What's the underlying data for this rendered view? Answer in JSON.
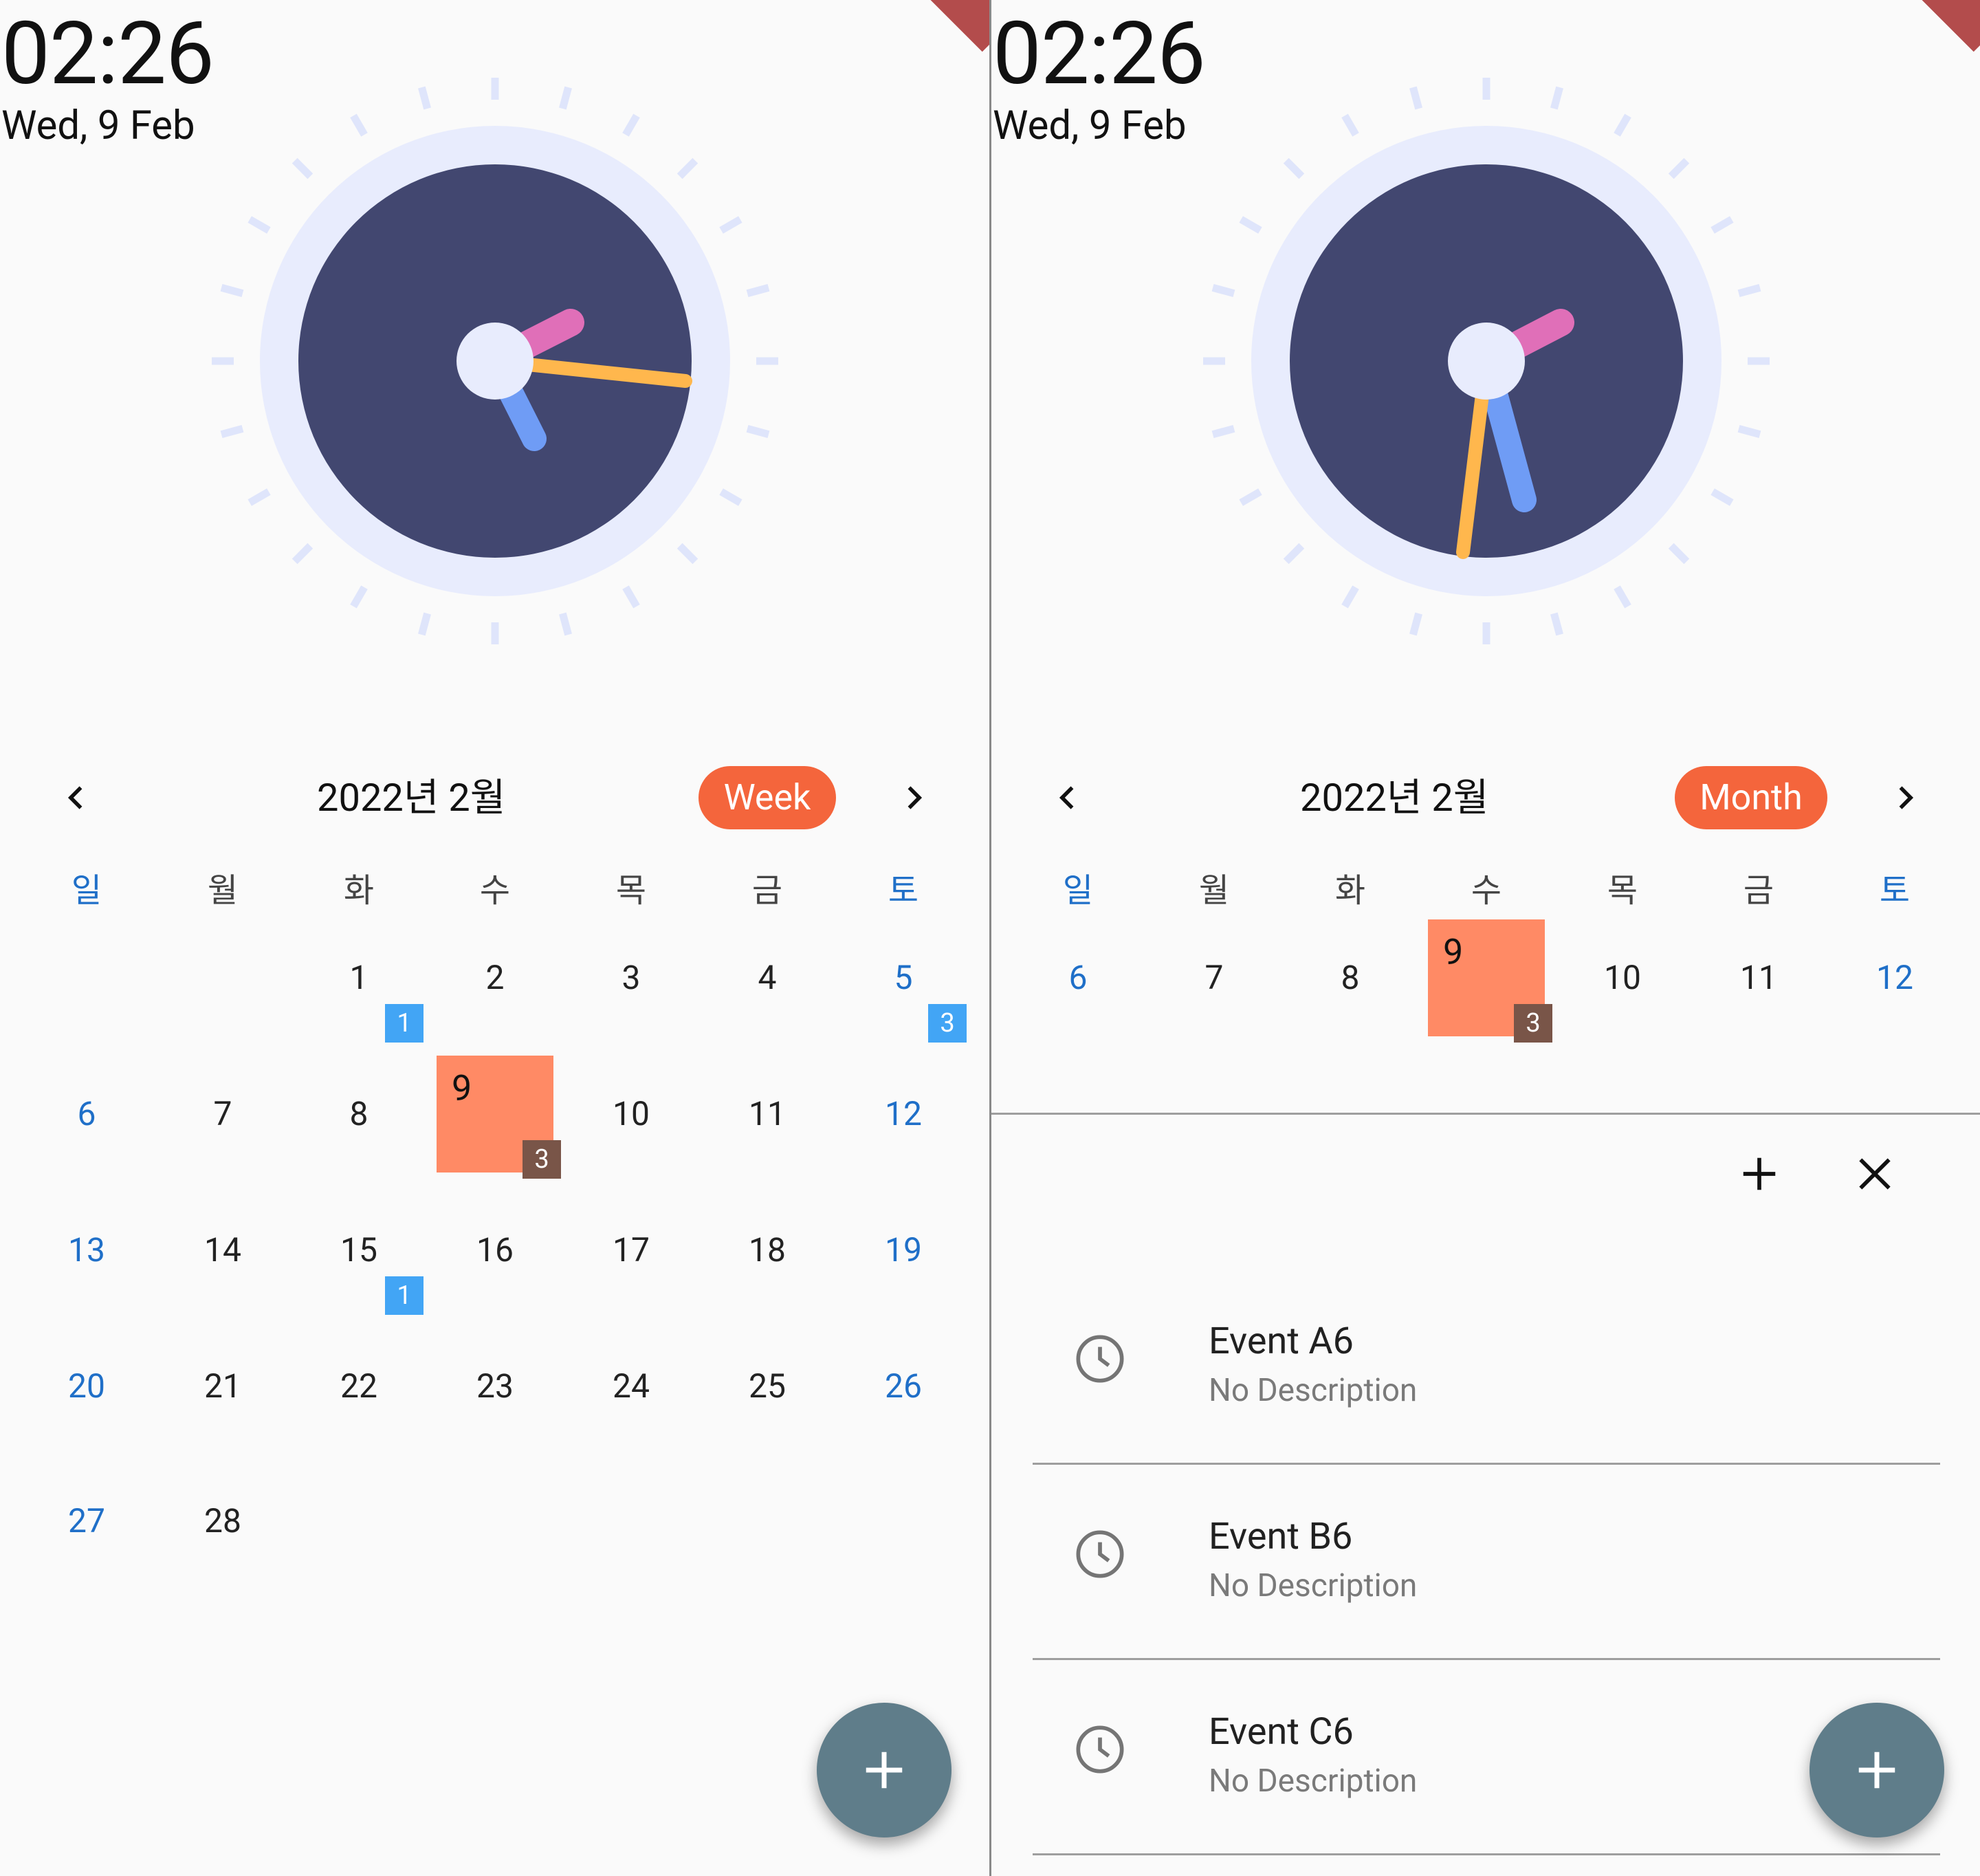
{
  "colors": {
    "accent_orange": "#f4653c",
    "today_fill": "#ff8a65",
    "weekend_blue": "#1f6fc8",
    "badge_blue": "#42a5f5",
    "badge_brown": "#795548",
    "clock_face": "#424770",
    "clock_ring": "#e8ecfd",
    "hand_hour": "#e06fb8",
    "hand_minute": "#6f9cf5",
    "hand_second": "#ffb74d",
    "fab": "#5f7d8a"
  },
  "left": {
    "time": "02:26",
    "date": "Wed, 9 Feb",
    "calendar_title": "2022년 2월",
    "mode_button": "Week",
    "weekdays": [
      "일",
      "월",
      "화",
      "수",
      "목",
      "금",
      "토"
    ],
    "weeks": [
      [
        "",
        "",
        "1",
        "2",
        "3",
        "4",
        "5"
      ],
      [
        "6",
        "7",
        "8",
        "9",
        "10",
        "11",
        "12"
      ],
      [
        "13",
        "14",
        "15",
        "16",
        "17",
        "18",
        "19"
      ],
      [
        "20",
        "21",
        "22",
        "23",
        "24",
        "25",
        "26"
      ],
      [
        "27",
        "28",
        "",
        "",
        "",
        "",
        ""
      ]
    ],
    "badges": {
      "feb1": "1",
      "feb5": "3",
      "feb9": "3",
      "feb15": "1"
    },
    "icons": [
      "chevron-left-icon",
      "chevron-right-icon",
      "plus-icon"
    ]
  },
  "right": {
    "time": "02:26",
    "date": "Wed, 9 Feb",
    "calendar_title": "2022년 2월",
    "mode_button": "Month",
    "weekdays": [
      "일",
      "월",
      "화",
      "수",
      "목",
      "금",
      "토"
    ],
    "week": [
      "6",
      "7",
      "8",
      "9",
      "10",
      "11",
      "12"
    ],
    "badges": {
      "feb9": "3"
    },
    "events": [
      {
        "title": "Event A6",
        "description": "No Description"
      },
      {
        "title": "Event B6",
        "description": "No Description"
      },
      {
        "title": "Event C6",
        "description": "No Description"
      }
    ],
    "icons": [
      "chevron-left-icon",
      "chevron-right-icon",
      "plus-icon",
      "close-icon",
      "clock-icon"
    ]
  }
}
